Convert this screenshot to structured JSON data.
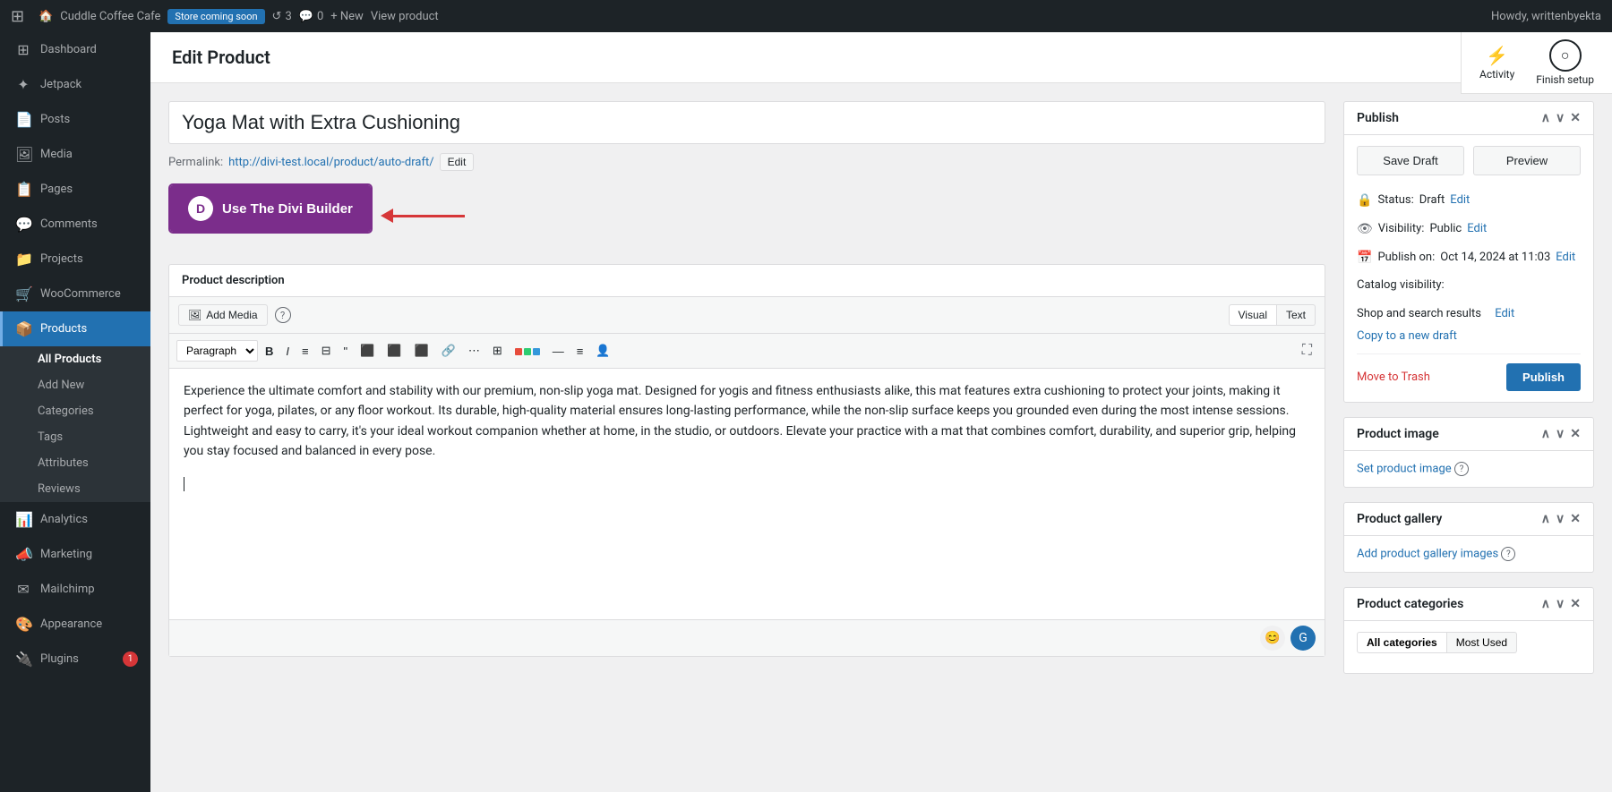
{
  "adminbar": {
    "logo": "⚙",
    "site_name": "Cuddle Coffee Cafe",
    "store_badge": "Store coming soon",
    "revisions": "3",
    "comments": "0",
    "new_label": "+ New",
    "view_label": "View product",
    "howdy": "Howdy, writtenbyekta"
  },
  "sidebar": {
    "items": [
      {
        "id": "dashboard",
        "label": "Dashboard",
        "icon": "⊞"
      },
      {
        "id": "jetpack",
        "label": "Jetpack",
        "icon": "✦"
      },
      {
        "id": "posts",
        "label": "Posts",
        "icon": "📄"
      },
      {
        "id": "media",
        "label": "Media",
        "icon": "🖼"
      },
      {
        "id": "pages",
        "label": "Pages",
        "icon": "📋"
      },
      {
        "id": "comments",
        "label": "Comments",
        "icon": "💬"
      },
      {
        "id": "projects",
        "label": "Projects",
        "icon": "📁"
      },
      {
        "id": "woocommerce",
        "label": "WooCommerce",
        "icon": "🛒"
      },
      {
        "id": "products",
        "label": "Products",
        "icon": "📦"
      },
      {
        "id": "analytics",
        "label": "Analytics",
        "icon": "📊"
      },
      {
        "id": "marketing",
        "label": "Marketing",
        "icon": "📣"
      },
      {
        "id": "mailchimp",
        "label": "Mailchimp",
        "icon": "✉"
      },
      {
        "id": "appearance",
        "label": "Appearance",
        "icon": "🎨"
      },
      {
        "id": "plugins",
        "label": "Plugins",
        "icon": "🔌",
        "badge": "1"
      }
    ],
    "submenu": [
      {
        "id": "all-products",
        "label": "All Products"
      },
      {
        "id": "add-new",
        "label": "Add New"
      },
      {
        "id": "categories",
        "label": "Categories"
      },
      {
        "id": "tags",
        "label": "Tags"
      },
      {
        "id": "attributes",
        "label": "Attributes"
      },
      {
        "id": "reviews",
        "label": "Reviews"
      }
    ]
  },
  "page": {
    "title": "Edit Product"
  },
  "top_right": {
    "activity_label": "Activity",
    "finish_setup_label": "Finish setup"
  },
  "product": {
    "title": "Yoga Mat with Extra Cushioning",
    "permalink_label": "Permalink:",
    "permalink_url": "http://divi-test.local/product/auto-draft/",
    "permalink_edit": "Edit",
    "divi_btn_label": "Use The Divi Builder",
    "divi_letter": "D"
  },
  "editor": {
    "description_label": "Product description",
    "add_media_label": "Add Media",
    "visual_label": "Visual",
    "text_label": "Text",
    "paragraph_option": "Paragraph",
    "content": "Experience the ultimate comfort and stability with our premium, non-slip yoga mat. Designed for yogis and fitness enthusiasts alike, this mat features extra cushioning to protect your joints, making it perfect for yoga, pilates, or any floor workout. Its durable, high-quality material ensures long-lasting performance, while the non-slip surface keeps you grounded even during the most intense sessions. Lightweight and easy to carry, it's your ideal workout companion whether at home, in the studio, or outdoors. Elevate your practice with a mat that combines comfort, durability, and superior grip, helping you stay focused and balanced in every pose."
  },
  "publish": {
    "panel_title": "Publish",
    "save_draft_label": "Save Draft",
    "preview_label": "Preview",
    "status_label": "Status:",
    "status_value": "Draft",
    "status_edit": "Edit",
    "visibility_label": "Visibility:",
    "visibility_value": "Public",
    "visibility_edit": "Edit",
    "publish_on_label": "Publish on:",
    "publish_on_value": "Oct 14, 2024 at 11:03",
    "publish_on_edit": "Edit",
    "catalog_label": "Catalog visibility:",
    "catalog_value": "Shop and search results",
    "catalog_edit": "Edit",
    "copy_draft_label": "Copy to a new draft",
    "trash_label": "Move to Trash",
    "publish_btn": "Publish"
  },
  "product_image": {
    "panel_title": "Product image",
    "set_image_label": "Set product image"
  },
  "product_gallery": {
    "panel_title": "Product gallery",
    "add_gallery_label": "Add product gallery images"
  },
  "product_categories": {
    "panel_title": "Product categories",
    "all_tab": "All categories",
    "used_tab": "Most Used"
  },
  "toolbar": {
    "bold": "B",
    "italic": "I",
    "ul": "≡",
    "ol": "#",
    "blockquote": "❝",
    "align_left": "⬛",
    "align_center": "⬛",
    "align_right": "⬛",
    "link": "🔗",
    "more": "⋯",
    "table": "⊞",
    "colorpicker": "🎨",
    "divider": "—",
    "strikethrough": "≡",
    "person": "👤",
    "expand": "⛶"
  }
}
